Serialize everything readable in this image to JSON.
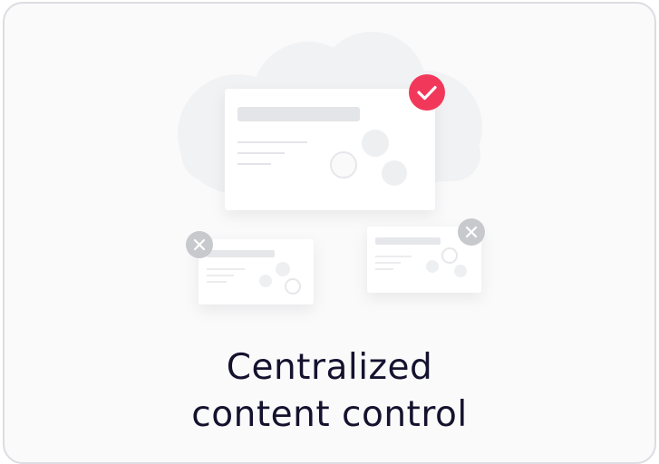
{
  "card": {
    "title_line1": "Centralized",
    "title_line2": "content control"
  },
  "colors": {
    "accent": "#f2385a",
    "muted_badge": "#c8c9cd",
    "title": "#14122e",
    "border": "#dcdde2"
  },
  "icons": {
    "approved": "checkmark-badge-icon",
    "rejected": "close-badge-icon"
  }
}
